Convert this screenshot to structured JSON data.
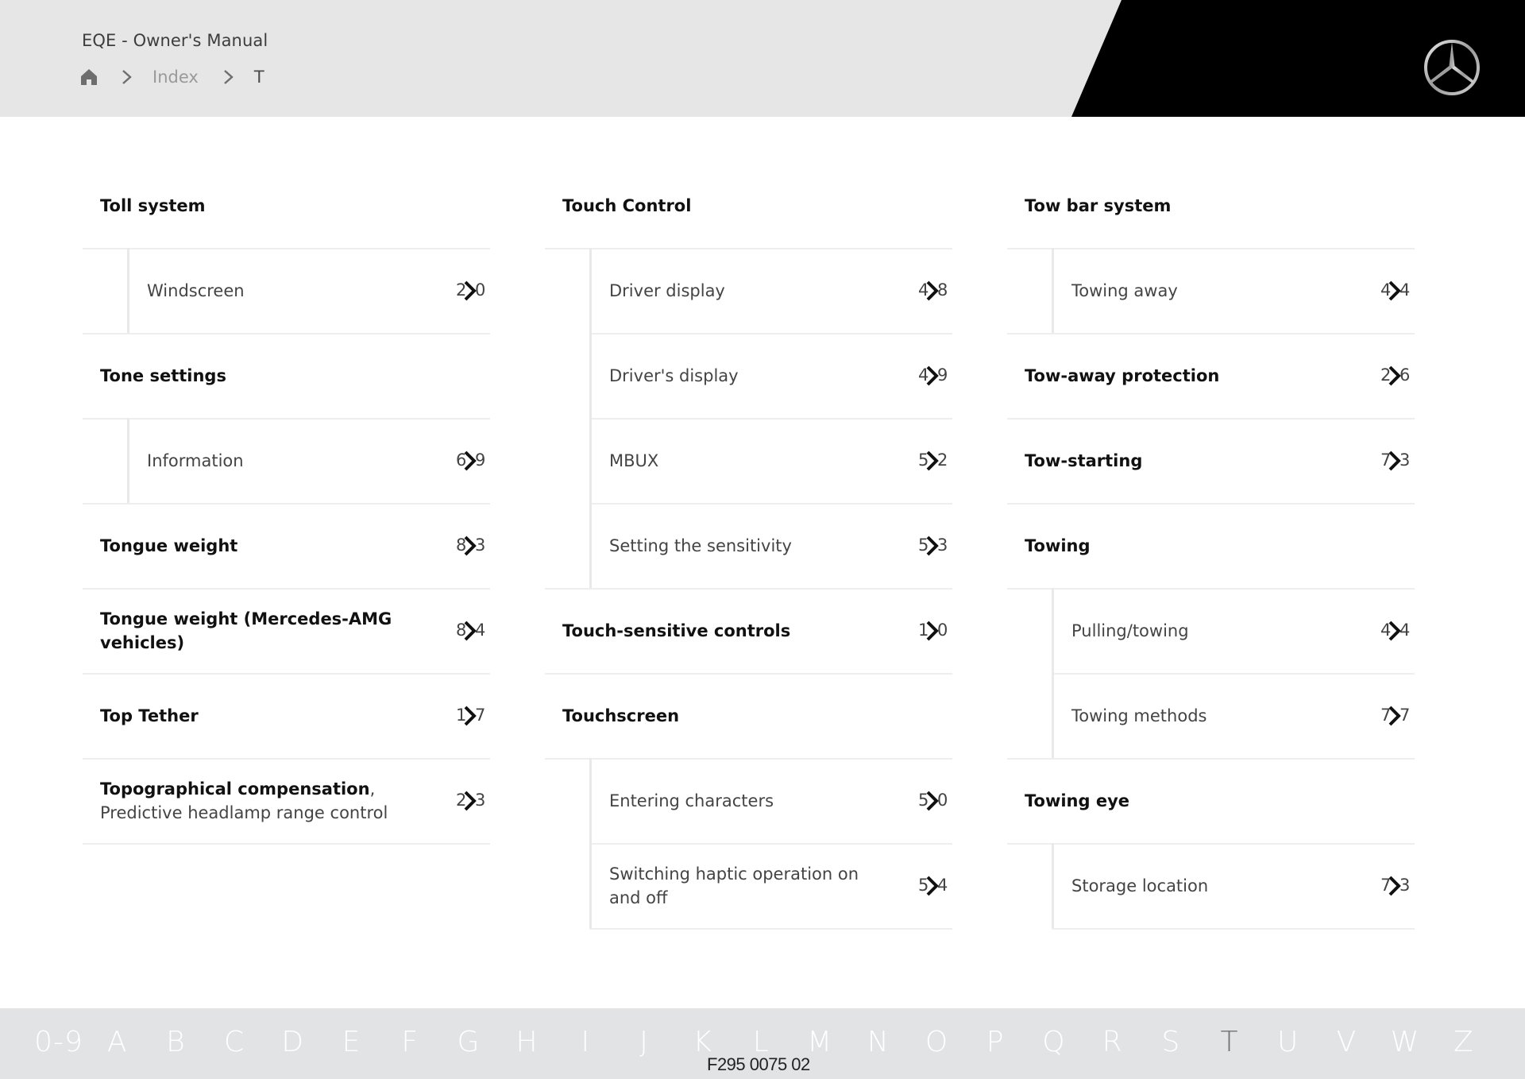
{
  "header": {
    "title": "EQE - Owner's Manual",
    "breadcrumb": {
      "home_icon": "home-icon",
      "index": "Index",
      "current": "T"
    },
    "logo": "mercedes-benz-star-logo",
    "colors": {
      "header_bg": "#e6e6e6",
      "brand_black": "#000000"
    }
  },
  "columns": [
    {
      "rows": [
        {
          "type": "heading",
          "label": "Toll system"
        },
        {
          "type": "sub",
          "label": "Windscreen",
          "page": [
            "2",
            "0"
          ]
        },
        {
          "type": "heading",
          "label": "Tone settings"
        },
        {
          "type": "sub",
          "label": "Information",
          "page": [
            "6",
            "9"
          ]
        },
        {
          "type": "heading",
          "label": "Tongue weight",
          "page": [
            "8",
            "3"
          ]
        },
        {
          "type": "heading",
          "label": "Tongue weight (Mercedes-AMG vehicles)",
          "page": [
            "8",
            "4"
          ]
        },
        {
          "type": "heading",
          "label": "Top Tether",
          "page": [
            "1",
            "7"
          ]
        },
        {
          "type": "heading",
          "label": "Topographical compensation",
          "suffix": ", Predictive headlamp range control",
          "page": [
            "2",
            "3"
          ]
        }
      ]
    },
    {
      "rows": [
        {
          "type": "heading",
          "label": "Touch Control"
        },
        {
          "type": "sub",
          "label": "Driver display",
          "page": [
            "4",
            "8"
          ]
        },
        {
          "type": "sub",
          "label": "Driver's display",
          "page": [
            "4",
            "9"
          ]
        },
        {
          "type": "sub",
          "label": "MBUX",
          "page": [
            "5",
            "2"
          ]
        },
        {
          "type": "sub",
          "label": "Setting the sensitivity",
          "page": [
            "5",
            "3"
          ]
        },
        {
          "type": "heading",
          "label": "Touch-sensitive controls",
          "page": [
            "1",
            "0"
          ]
        },
        {
          "type": "heading",
          "label": "Touchscreen"
        },
        {
          "type": "sub",
          "label": "Entering characters",
          "page": [
            "5",
            "0"
          ]
        },
        {
          "type": "sub",
          "label": "Switching haptic operation on and off",
          "page": [
            "5",
            "4"
          ]
        }
      ]
    },
    {
      "rows": [
        {
          "type": "heading",
          "label": "Tow bar system"
        },
        {
          "type": "sub",
          "label": "Towing away",
          "page": [
            "4",
            "4"
          ]
        },
        {
          "type": "heading",
          "label": "Tow-away protection",
          "page": [
            "2",
            "6"
          ]
        },
        {
          "type": "heading",
          "label": "Tow-starting",
          "page": [
            "7",
            "3"
          ]
        },
        {
          "type": "heading",
          "label": "Towing"
        },
        {
          "type": "sub",
          "label": "Pulling/towing",
          "page": [
            "4",
            "4"
          ]
        },
        {
          "type": "sub",
          "label": "Towing methods",
          "page": [
            "7",
            "7"
          ]
        },
        {
          "type": "heading",
          "label": "Towing eye"
        },
        {
          "type": "sub",
          "label": "Storage location",
          "page": [
            "7",
            "3"
          ]
        }
      ]
    }
  ],
  "alphabet": {
    "letters": [
      "0-9",
      "A",
      "B",
      "C",
      "D",
      "E",
      "F",
      "G",
      "H",
      "I",
      "J",
      "K",
      "L",
      "M",
      "N",
      "O",
      "P",
      "Q",
      "R",
      "S",
      "T",
      "U",
      "V",
      "W",
      "Z"
    ],
    "active": "T",
    "colors": {
      "inactive": "#ffffff",
      "active": "#707070",
      "bar_bg": "#e2e3e4"
    }
  },
  "document_code": "F295 0075 02"
}
